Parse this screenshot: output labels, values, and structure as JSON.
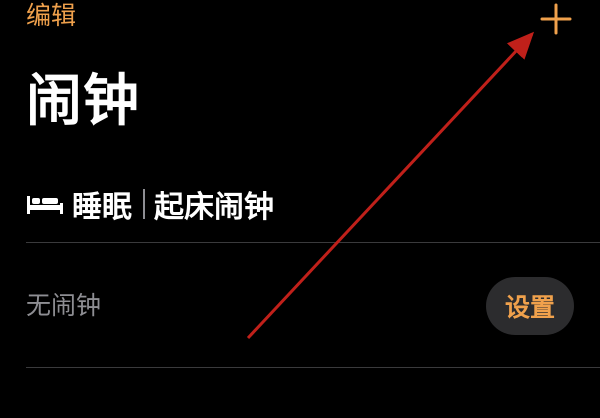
{
  "nav": {
    "edit_label": "编辑",
    "add_icon": "plus-icon"
  },
  "title": "闹钟",
  "sleep_section": {
    "icon": "bed-icon",
    "sleep_label": "睡眠",
    "wake_label": "起床闹钟",
    "status": "无闹钟",
    "set_label": "设置"
  },
  "colors": {
    "accent": "#f0a14c",
    "background": "#000000",
    "secondary_text": "#8e8e93",
    "button_bg": "#2c2c2e",
    "annotation_arrow": "#c0201a"
  }
}
